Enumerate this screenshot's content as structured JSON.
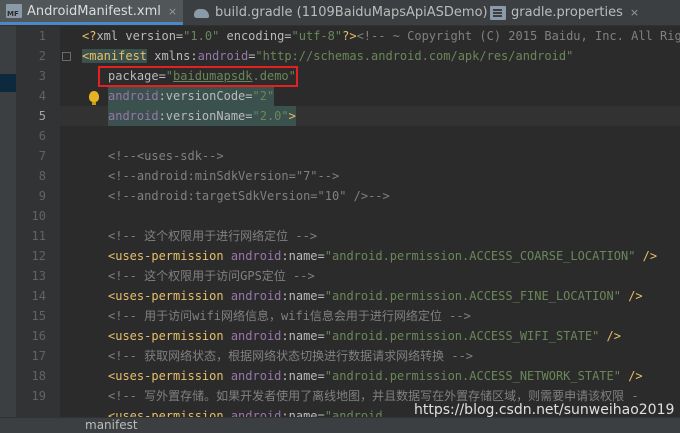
{
  "tabs": [
    {
      "label": "AndroidManifest.xml",
      "icon": "manifest-file-icon",
      "active": true
    },
    {
      "label": "build.gradle (1109BaiduMapsApiASDemo)",
      "icon": "gradle-file-icon",
      "active": false
    },
    {
      "label": "gradle.properties",
      "icon": "properties-file-icon",
      "active": false
    }
  ],
  "tab_close_symbol": "×",
  "line_numbers": [
    "1",
    "2",
    "3",
    "4",
    "5",
    "6",
    "7",
    "8",
    "9",
    "10",
    "11",
    "12",
    "13",
    "14",
    "15",
    "16",
    "17",
    "18",
    "19",
    "20",
    "21"
  ],
  "code": {
    "l1": {
      "a": "<?",
      "b": "xml version=",
      "c": "\"1.0\"",
      "d": " encoding=",
      "e": "\"utf-8\"",
      "f": "?>",
      "g": "<!-- ~ Copyright (C) 2015 Baidu, Inc. All Rights"
    },
    "l2": {
      "a": "<",
      "b": "manifest",
      "c": " xmlns:",
      "d": "android",
      "e": "=",
      "f": "\"http://schemas.android.com/apk/res/android\""
    },
    "l3": {
      "a": "package=",
      "b": "\"",
      "c": "baidumapsdk",
      "d": ".demo\""
    },
    "l4": {
      "a": "android",
      "b": ":versionCode=",
      "c": "\"2\""
    },
    "l5": {
      "a": "android",
      "b": ":versionName=",
      "c": "\"2.0\"",
      "d": ">"
    },
    "l7": "<!--<uses-sdk-->",
    "l8": "<!--android:minSdkVersion=\"7\"-->",
    "l9": "<!--android:targetSdkVersion=\"10\" />-->",
    "l11": "<!-- 这个权限用于进行网络定位 -->",
    "l12": {
      "a": "<uses-permission ",
      "b": "android",
      "c": ":name=",
      "d": "\"android.permission.ACCESS_COARSE_LOCATION\"",
      "e": " />"
    },
    "l13": "<!-- 这个权限用于访问GPS定位 -->",
    "l14": {
      "a": "<uses-permission ",
      "b": "android",
      "c": ":name=",
      "d": "\"android.permission.ACCESS_FINE_LOCATION\"",
      "e": " />"
    },
    "l15": "<!-- 用于访问wifi网络信息，wifi信息会用于进行网络定位 -->",
    "l16": {
      "a": "<uses-permission ",
      "b": "android",
      "c": ":name=",
      "d": "\"android.permission.ACCESS_WIFI_STATE\"",
      "e": " />"
    },
    "l17": "<!-- 获取网络状态，根据网络状态切换进行数据请求网络转换 -->",
    "l18": {
      "a": "<uses-permission ",
      "b": "android",
      "c": ":name=",
      "d": "\"android.permission.ACCESS_NETWORK_STATE\"",
      "e": " />"
    },
    "l19": "<!-- 写外置存储。如果开发者使用了离线地图，并且数据写在外置存储区域，则需要申请该权限 -",
    "l20": {
      "a": "<uses-permission ",
      "b": "android",
      "c": ":name=",
      "d": "\"android"
    }
  },
  "watermark": "https://blog.csdn.net/sunweihao2019",
  "breadcrumb": "manifest",
  "colors": {
    "accent": "#4a88c7",
    "highlight_box": "#e52020",
    "tag": "#e8bf6a",
    "string": "#6a8759",
    "namespace": "#9876aa",
    "comment": "#808080"
  }
}
